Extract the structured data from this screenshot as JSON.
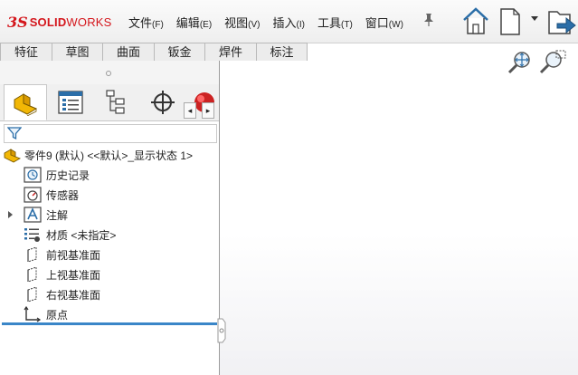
{
  "app": {
    "logo_prefix": "3S",
    "logo_bold": "SOLID",
    "logo_thin": "WORKS"
  },
  "menu": [
    {
      "label": "文件",
      "key": "(F)"
    },
    {
      "label": "编辑",
      "key": "(E)"
    },
    {
      "label": "视图",
      "key": "(V)"
    },
    {
      "label": "插入",
      "key": "(I)"
    },
    {
      "label": "工具",
      "key": "(T)"
    },
    {
      "label": "窗口",
      "key": "(W)"
    }
  ],
  "command_tabs": [
    "特征",
    "草图",
    "曲面",
    "钣金",
    "焊件",
    "标注"
  ],
  "tree": {
    "root": "零件9 (默认) <<默认>_显示状态 1>",
    "items": [
      "历史记录",
      "传感器",
      "注解",
      "材质 <未指定>",
      "前视基准面",
      "上视基准面",
      "右视基准面",
      "原点"
    ]
  },
  "colors": {
    "brand": "#d4161c",
    "rollback_bar": "#3a86c8",
    "part_icon": "#f2b705"
  }
}
